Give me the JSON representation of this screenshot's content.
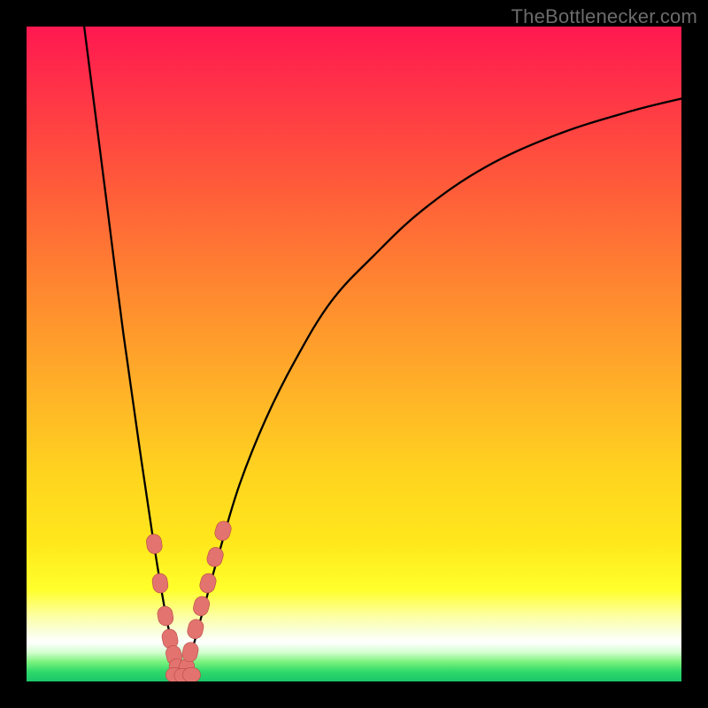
{
  "watermark": "TheBottlenecker.com",
  "colors": {
    "curve": "#000000",
    "marker_fill": "#e2736f",
    "marker_stroke": "#b94a45",
    "frame_bg": "#000000"
  },
  "chart_data": {
    "type": "line",
    "title": "",
    "xlabel": "",
    "ylabel": "",
    "xlim": [
      0,
      100
    ],
    "ylim": [
      0,
      100
    ],
    "grid": false,
    "legend": false,
    "series": [
      {
        "name": "left-branch",
        "x": [
          8.8,
          12.0,
          14.8,
          17.5,
          19.6,
          21.3,
          22.6,
          23.5
        ],
        "values": [
          100.0,
          75.0,
          53.0,
          34.0,
          20.0,
          10.0,
          4.0,
          1.0
        ]
      },
      {
        "name": "right-branch",
        "x": [
          23.5,
          25.0,
          27.0,
          29.5,
          32.5,
          36.5,
          41.0,
          46.5,
          53.0,
          60.5,
          70.0,
          81.0,
          92.0,
          100.0
        ],
        "values": [
          1.0,
          4.0,
          11.0,
          20.0,
          30.0,
          40.0,
          49.0,
          58.0,
          65.0,
          72.0,
          78.5,
          83.5,
          87.0,
          89.0
        ]
      }
    ],
    "markers_left": [
      {
        "x": 19.5,
        "y": 21.0
      },
      {
        "x": 20.4,
        "y": 15.0
      },
      {
        "x": 21.2,
        "y": 10.0
      },
      {
        "x": 21.9,
        "y": 6.5
      },
      {
        "x": 22.5,
        "y": 4.0
      },
      {
        "x": 23.0,
        "y": 2.0
      }
    ],
    "markers_right": [
      {
        "x": 24.4,
        "y": 2.0
      },
      {
        "x": 25.0,
        "y": 4.5
      },
      {
        "x": 25.8,
        "y": 8.0
      },
      {
        "x": 26.7,
        "y": 11.5
      },
      {
        "x": 27.7,
        "y": 15.0
      },
      {
        "x": 28.8,
        "y": 19.0
      },
      {
        "x": 30.0,
        "y": 23.0
      }
    ],
    "markers_bottom": [
      {
        "x": 22.6,
        "y": 1.0
      },
      {
        "x": 23.9,
        "y": 0.9
      },
      {
        "x": 25.2,
        "y": 1.0
      }
    ]
  }
}
